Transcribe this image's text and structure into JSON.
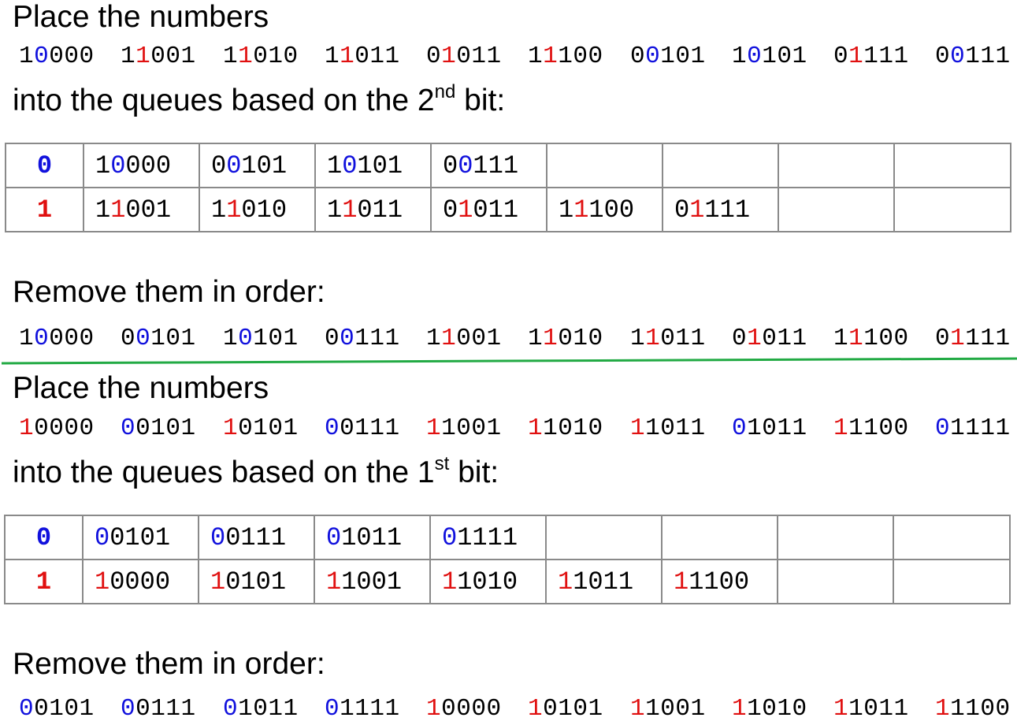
{
  "colors": {
    "bit_zero": "#1111dd",
    "bit_one": "#e01010",
    "divider": "#22aa44",
    "grid": "#8a8a8a"
  },
  "pass1": {
    "place_label": "Place the numbers",
    "input_numbers": [
      "10000",
      "11001",
      "11010",
      "11011",
      "01011",
      "11100",
      "00101",
      "10101",
      "01111",
      "00111"
    ],
    "into_prefix": "into the queues based on the 2",
    "ordinal_suffix": "nd",
    "into_suffix": " bit:",
    "bit_index": 1,
    "queue_labels": [
      "0",
      "1"
    ],
    "queues": [
      [
        "10000",
        "00101",
        "10101",
        "00111",
        "",
        "",
        "",
        ""
      ],
      [
        "11001",
        "11010",
        "11011",
        "01011",
        "11100",
        "01111",
        "",
        ""
      ]
    ],
    "remove_label": "Remove them in order:",
    "output_numbers": [
      "10000",
      "00101",
      "10101",
      "00111",
      "11001",
      "11010",
      "11011",
      "01011",
      "11100",
      "01111"
    ]
  },
  "pass2": {
    "place_label": "Place the numbers",
    "input_numbers": [
      "10000",
      "00101",
      "10101",
      "00111",
      "11001",
      "11010",
      "11011",
      "01011",
      "11100",
      "01111"
    ],
    "into_prefix": "into the queues based on the 1",
    "ordinal_suffix": "st",
    "into_suffix": " bit:",
    "bit_index": 0,
    "queue_labels": [
      "0",
      "1"
    ],
    "queues": [
      [
        "00101",
        "00111",
        "01011",
        "01111",
        "",
        "",
        "",
        ""
      ],
      [
        "10000",
        "10101",
        "11001",
        "11010",
        "11011",
        "11100",
        "",
        ""
      ]
    ],
    "remove_label": "Remove them in order:",
    "output_numbers": [
      "00101",
      "00111",
      "01011",
      "01111",
      "10000",
      "10101",
      "11001",
      "11010",
      "11011",
      "11100"
    ]
  }
}
